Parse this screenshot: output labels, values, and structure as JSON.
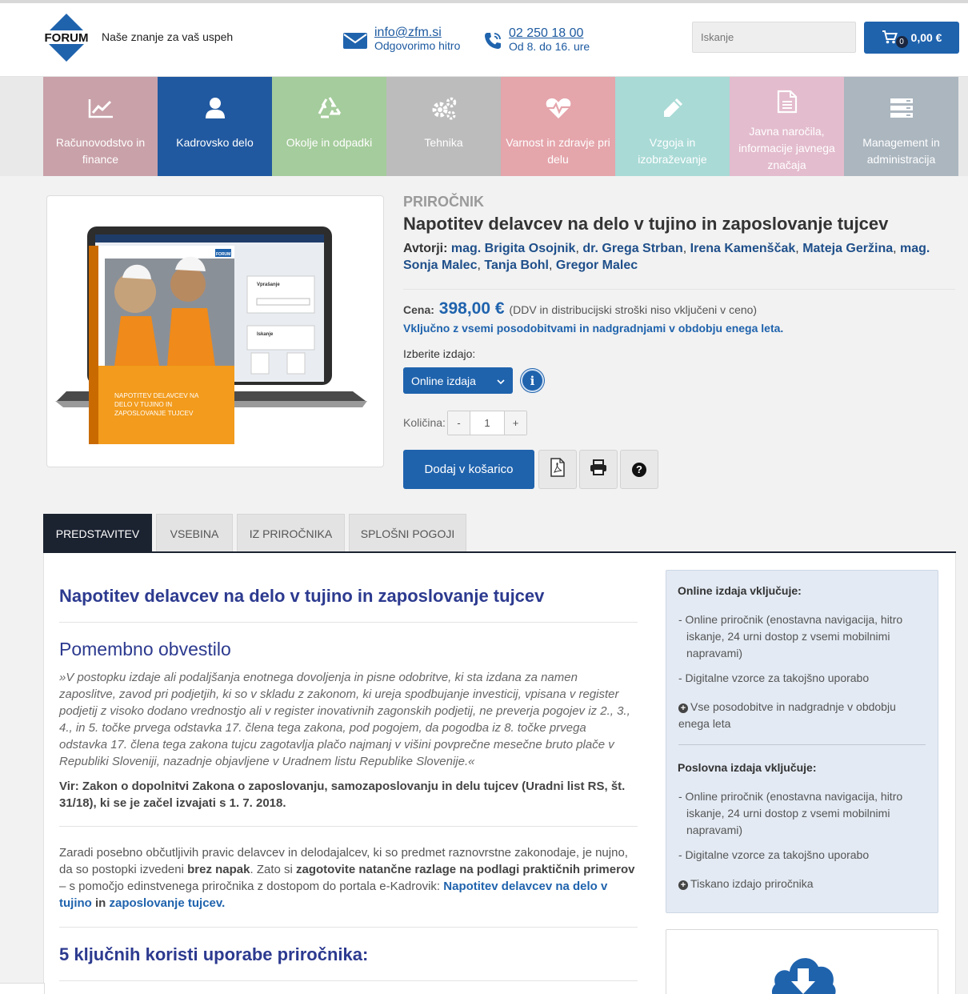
{
  "header": {
    "brand": "FORUM",
    "tagline": "Naše znanje za vaš uspeh",
    "email": "info@zfm.si",
    "email_sub": "Odgovorimo hitro",
    "phone": "02 250 18 00",
    "phone_sub": "Od 8. do 16. ure",
    "search_placeholder": "Iskanje",
    "cart_count": "0",
    "cart_total": "0,00 €"
  },
  "categories": [
    {
      "label": "Računovodstvo in finance",
      "icon": "chart-line-icon",
      "color": "#c9a1a9"
    },
    {
      "label": "Kadrovsko delo",
      "icon": "user-icon",
      "color": "#2159a0"
    },
    {
      "label": "Okolje in odpadki",
      "icon": "recycle-icon",
      "color": "#a5cc9c"
    },
    {
      "label": "Tehnika",
      "icon": "gears-icon",
      "color": "#bcbcbc"
    },
    {
      "label": "Varnost in zdravje pri delu",
      "icon": "heartbeat-icon",
      "color": "#e4a5ab"
    },
    {
      "label": "Vzgoja in izobraževanje",
      "icon": "pencil-icon",
      "color": "#a9dad6"
    },
    {
      "label": "Javna naročila, informacije javnega značaja",
      "icon": "document-icon",
      "color": "#e3bccd"
    },
    {
      "label": "Management in administracija",
      "icon": "server-icon",
      "color": "#abb6bf"
    }
  ],
  "product": {
    "type": "PRIROČNIK",
    "title": "Napotitev delavcev na delo v tujino in zaposlovanje tujcev",
    "authors_label": "Avtorji:",
    "authors": [
      "mag. Brigita Osojnik",
      "dr. Grega Strban",
      "Irena Kamenščak",
      "Mateja Geržina",
      "mag. Sonja Malec",
      "Tanja Bohl",
      "Gregor Malec"
    ],
    "price_label": "Cena:",
    "price": "398,00 €",
    "price_note": "(DDV in distribucijski stroški niso vključeni v ceno)",
    "includes": "Vključno z vsemi posodobitvami in nadgradnjami v obdobju enega leta.",
    "edition_label": "Izberite izdajo:",
    "edition_selected": "Online izdaja",
    "info_glyph": "i",
    "qty_label": "Količina:",
    "qty_minus": "-",
    "qty_value": "1",
    "qty_plus": "+",
    "add_to_cart": "Dodaj v košarico",
    "help_glyph": "?",
    "book_cover": {
      "brand": "FORUM",
      "title": "NAPOTITEV DELAVCEV NA DELO V TUJINO IN ZAPOSLOVANJE TUJCEV",
      "screen_heading_1": "Vprašanje",
      "screen_heading_2": "Iskanje"
    }
  },
  "tabs": [
    "PREDSTAVITEV",
    "VSEBINA",
    "IZ PRIROČNIKA",
    "SPLOŠNI POGOJI"
  ],
  "article": {
    "title": "Napotitev delavcev na delo v tujino in zaposlovanje tujcev",
    "notice_title": "Pomembno obvestilo",
    "quote": "»V postopku izdaje ali podaljšanja enotnega dovoljenja in pisne odobritve, ki sta izdana za namen zaposlitve, zavod pri podjetjih, ki so v skladu z zakonom, ki ureja spodbujanje investicij, vpisana v register podjetij z visoko dodano vrednostjo ali v register inovativnih zagonskih podjetij, ne preverja pogojev iz 2., 3., 4., in 5. točke prvega odstavka 17. člena tega zakona, pod pogojem, da pogodba iz 8. točke prvega odstavka 17. člena tega zakona tujcu zagotavlja plačo najmanj v višini povprečne mesečne bruto plače v Republiki Sloveniji, nazadnje objavljene v Uradnem listu Republike Slovenije.«",
    "source": "Vir: Zakon o dopolnitvi Zakona o zaposlovanju, samozaposlovanju in delu tujcev (Uradni list RS, št. 31/18), ki se je začel izvajati s 1. 7. 2018.",
    "para": {
      "p1": "Zaradi posebno občutljivih pravic delavcev in delodajalcev, ki so predmet raznovrstne zakonodaje, je nujno, da so postopki izvedeni ",
      "b1": "brez napak",
      "p2": ". Zato si ",
      "b2": "zagotovite natančne razlage na podlagi praktičnih primerov",
      "p3": " – s pomočjo edinstvenega priročnika z dostopom do portala e-Kadrovik: ",
      "l1": "Napotitev delavcev na delo v tujino",
      "p4": " in ",
      "l2": "zaposlovanje tujcev."
    },
    "benefits_title": "5 ključnih koristi uporabe priročnika:"
  },
  "sidebar": {
    "online_title": "Online izdaja vključuje:",
    "online_items": [
      "- Online priročnik (enostavna navigacija, hitro iskanje, 24 urni dostop z vsemi mobilnimi napravami)",
      "- Digitalne vzorce za takojšno uporabo"
    ],
    "online_plus": "Vse posodobitve in nadgradnje v obdobju enega leta",
    "business_title": "Poslovna izdaja vključuje:",
    "business_items": [
      "- Online priročnik (enostavna navigacija, hitro iskanje, 24 urni dostop z vsemi mobilnimi napravami)",
      "- Digitalne vzorce za takojšno uporabo"
    ],
    "business_plus": "Tiskano izdajo priročnika"
  },
  "colors": {
    "accent": "#1f63ad",
    "heading": "#2c3a8f",
    "tab_active": "#1b2230"
  }
}
